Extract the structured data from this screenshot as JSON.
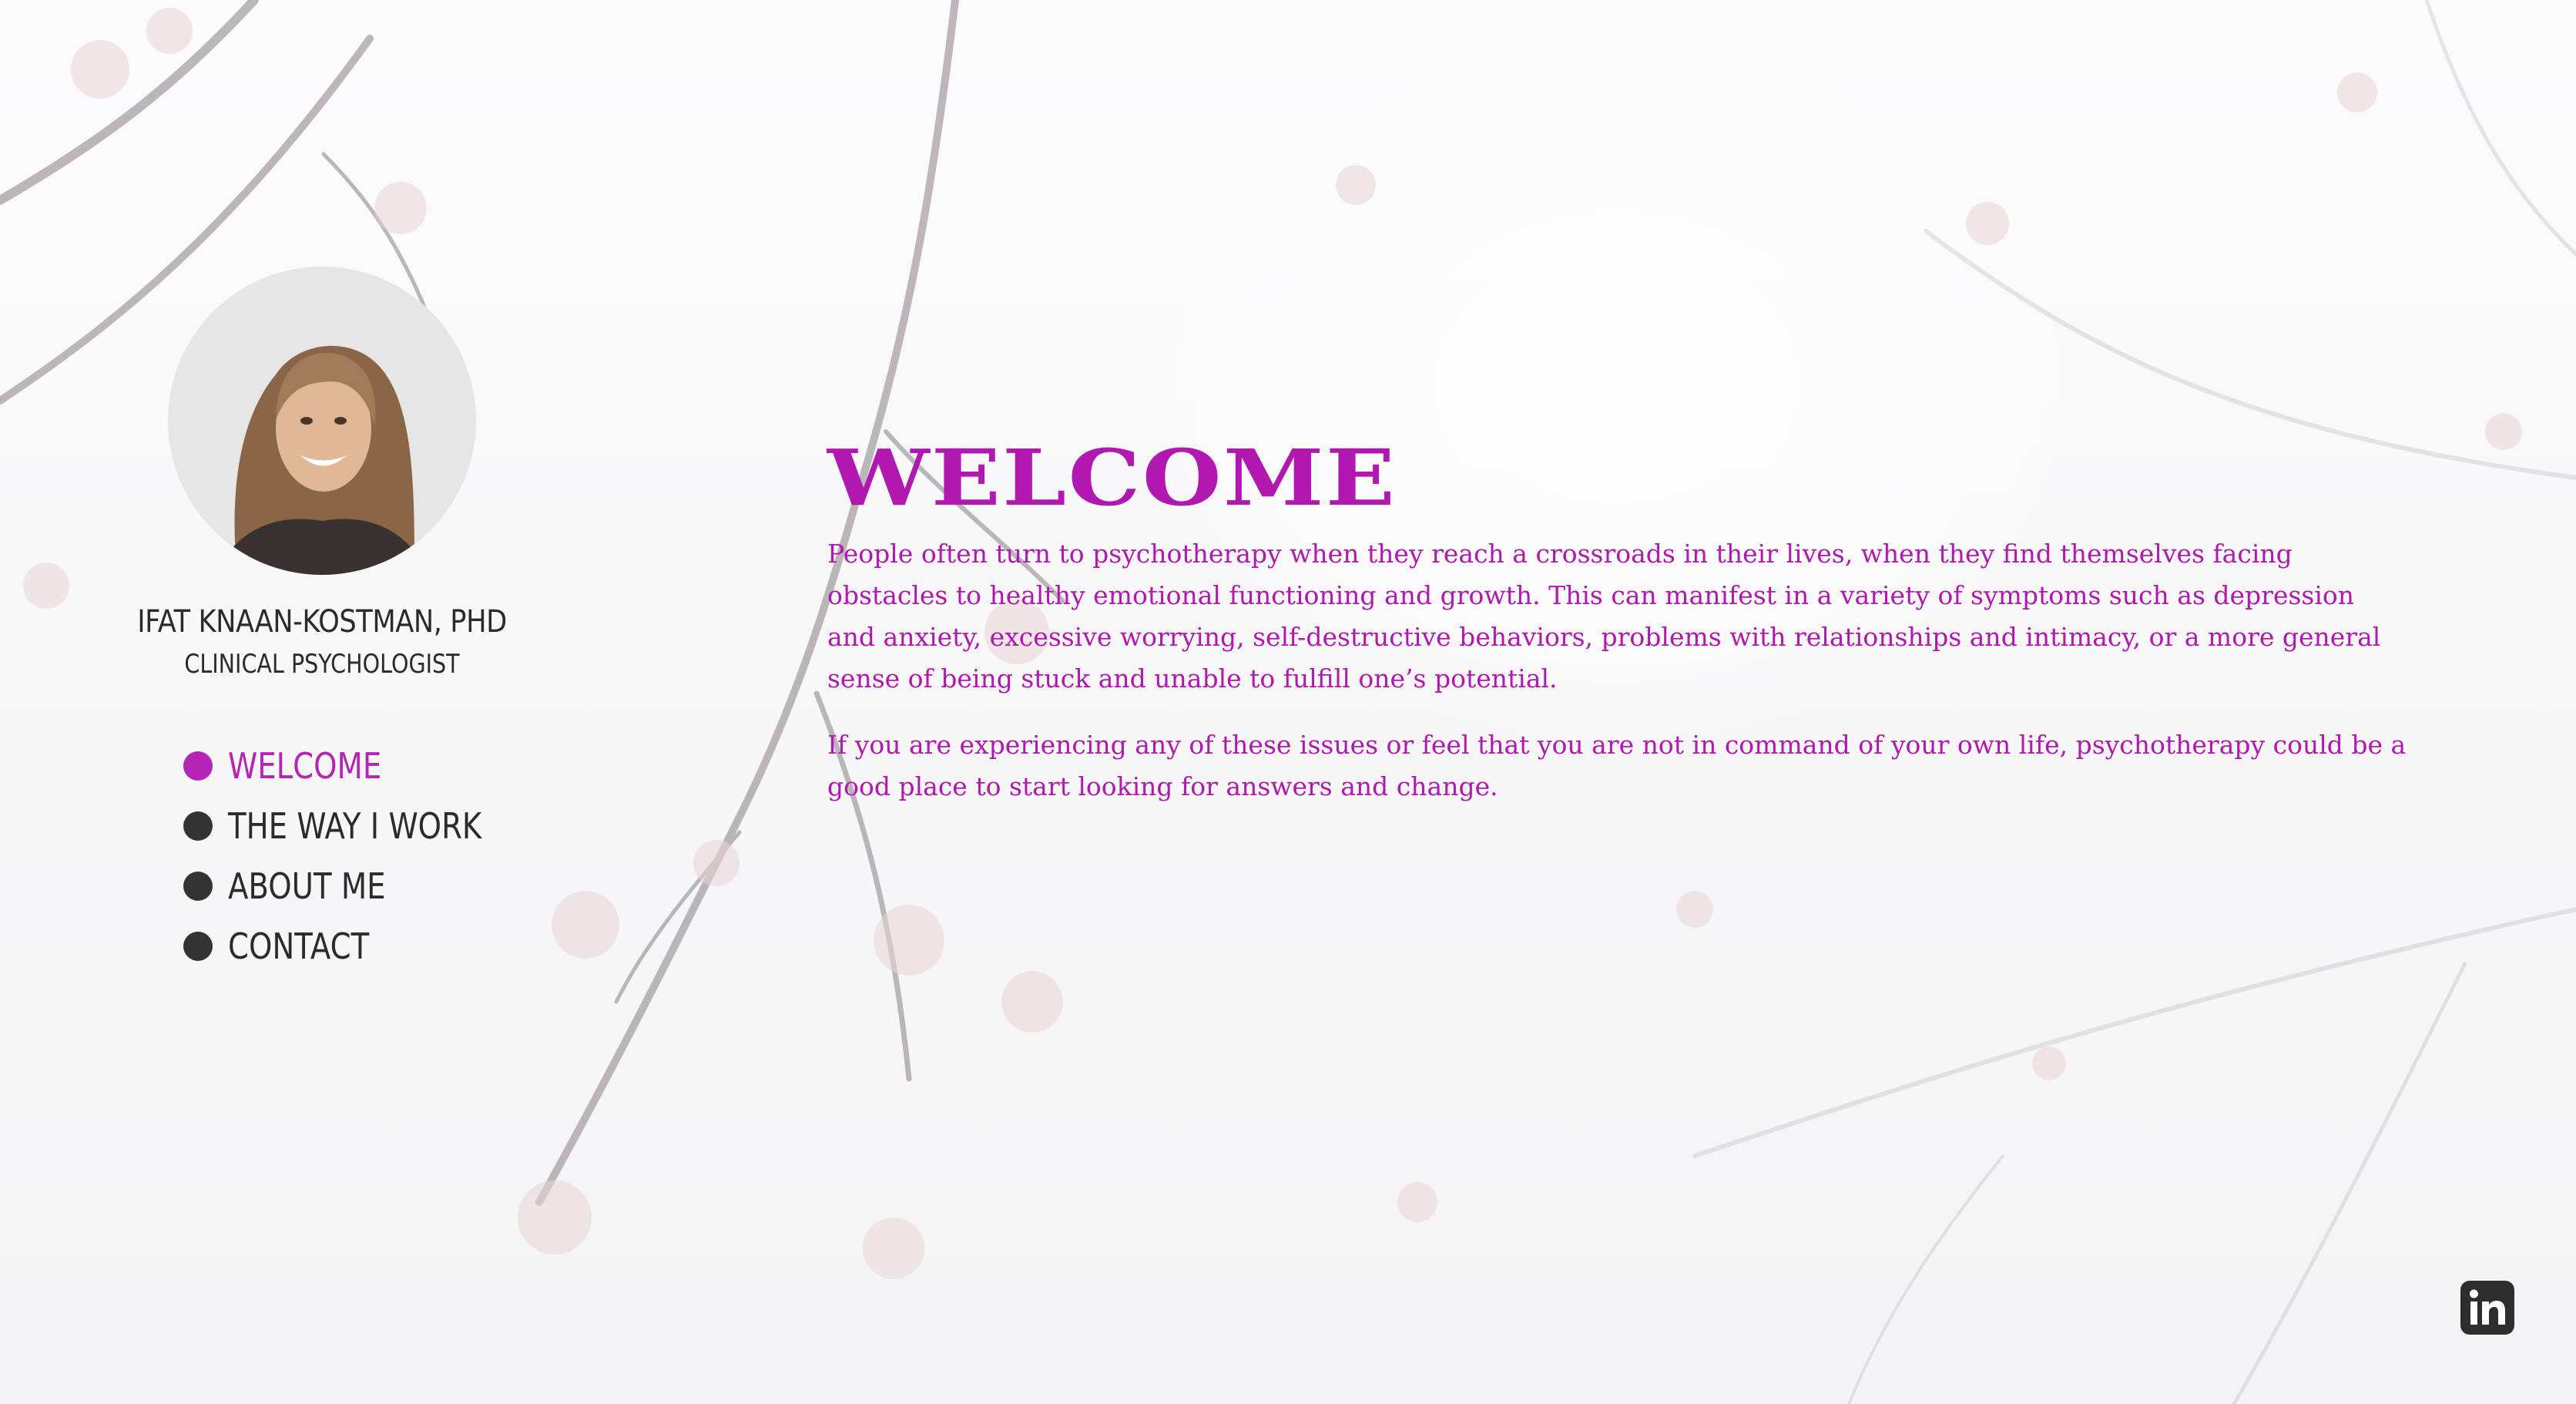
{
  "profile": {
    "name": "IFAT KNAAN-KOSTMAN, PHD",
    "title": "CLINICAL PSYCHOLOGIST"
  },
  "nav": {
    "items": [
      {
        "label": "WELCOME",
        "active": true
      },
      {
        "label": "THE WAY I WORK",
        "active": false
      },
      {
        "label": "ABOUT ME",
        "active": false
      },
      {
        "label": "CONTACT",
        "active": false
      }
    ]
  },
  "main": {
    "heading": "WELCOME",
    "paragraphs": [
      "People often turn to psychotherapy when they reach a crossroads in their lives, when they find themselves facing obstacles to healthy emotional functioning and growth. This can manifest in a variety of symptoms such as depression and anxiety, excessive worrying, self-destructive behaviors, problems with relationships and intimacy, or a more general sense of being stuck and unable to fulfill one’s potential.",
      "If you are experiencing any of these issues or feel that you are not in command of your own life, psychotherapy could be a good place to start looking for answers and change."
    ]
  },
  "social": {
    "icon": "linkedin-icon"
  },
  "colors": {
    "accent": "#b018b0",
    "text": "#2b2b2b"
  }
}
